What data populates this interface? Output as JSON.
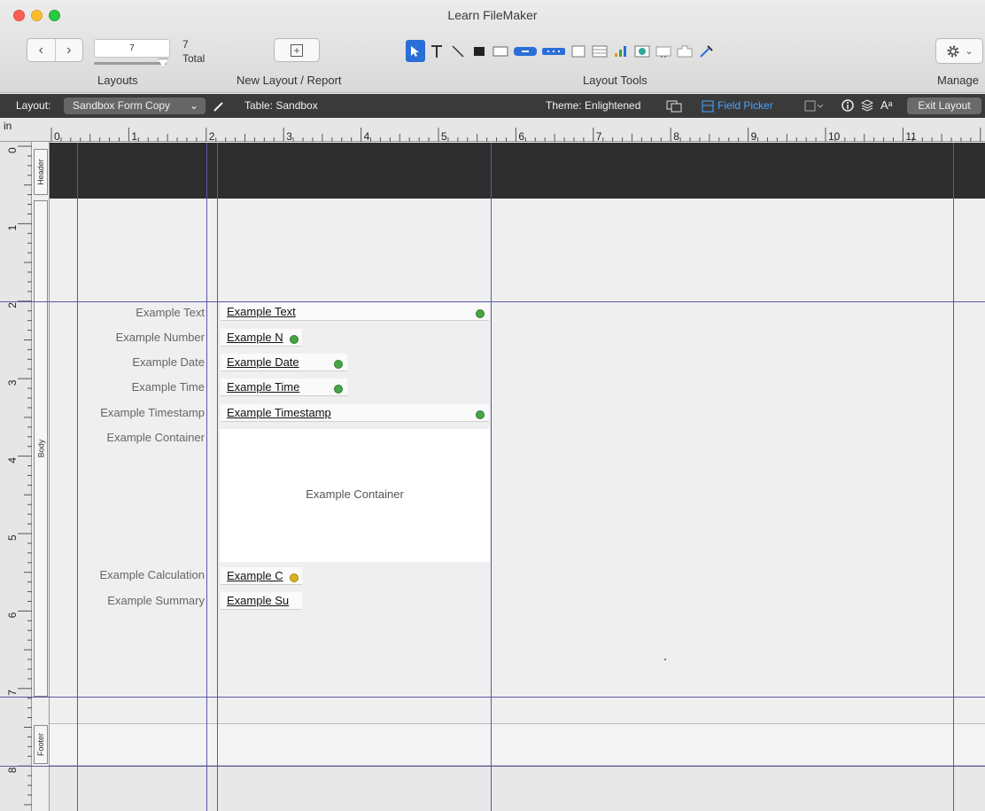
{
  "window": {
    "title": "Learn FileMaker"
  },
  "toolbar": {
    "layout_field": "7",
    "total_count": "7",
    "total_label": "Total",
    "layouts_label": "Layouts",
    "new_layout_label": "New Layout / Report",
    "layout_tools_label": "Layout Tools",
    "manage_label": "Manage"
  },
  "layout_bar": {
    "layout_label": "Layout:",
    "layout_name": "Sandbox Form Copy",
    "table": "Table: Sandbox",
    "theme": "Theme: Enlightened",
    "field_picker": "Field Picker",
    "exit_layout": "Exit Layout"
  },
  "ruler": {
    "unit": "in",
    "ticks": [
      "0",
      "1",
      "2",
      "3",
      "4",
      "5",
      "6",
      "7",
      "8",
      "9",
      "10",
      "11"
    ],
    "left_ticks": [
      "0",
      "1",
      "2",
      "3",
      "4",
      "5",
      "6",
      "7",
      "8"
    ]
  },
  "parts": {
    "header": "Header",
    "body": "Body",
    "footer": "Footer"
  },
  "fields": [
    {
      "label": "Example Text",
      "field": "Example Text"
    },
    {
      "label": "Example Number",
      "field": "Example N"
    },
    {
      "label": "Example Date",
      "field": "Example Date"
    },
    {
      "label": "Example Time",
      "field": "Example Time"
    },
    {
      "label": "Example Timestamp",
      "field": "Example Timestamp"
    },
    {
      "label": "Example Container",
      "field": "Example Container"
    },
    {
      "label": "Example Calculation",
      "field": "Example C"
    },
    {
      "label": "Example Summary",
      "field": "Example Su"
    }
  ],
  "colors": {
    "accent": "#2a6fd8",
    "guide": "#5a5aa8",
    "header_part": "#2e2e2e",
    "layout_bar": "#3a3a3a"
  }
}
